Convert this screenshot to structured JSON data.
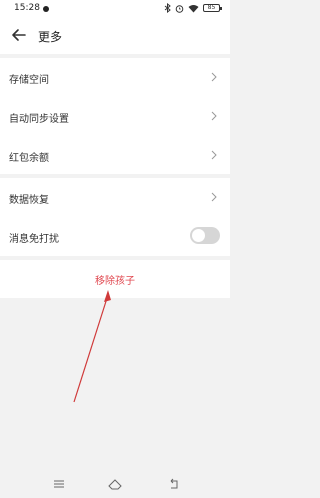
{
  "status_bar": {
    "time": "15:28",
    "battery": "85"
  },
  "header": {
    "title": "更多"
  },
  "settings_group_1": [
    {
      "label": "存储空间"
    },
    {
      "label": "自动同步设置"
    },
    {
      "label": "红包余额"
    }
  ],
  "settings_group_2": [
    {
      "label": "数据恢复"
    },
    {
      "label": "消息免打扰",
      "toggle_on": false
    }
  ],
  "remove_link": {
    "label": "移除孩子"
  },
  "colors": {
    "accent_red": "#e0474f",
    "toggle_off": "#d6d6d6",
    "background": "#f2f2f2"
  },
  "icons": [
    "bluetooth-icon",
    "alarm-icon",
    "wifi-icon",
    "battery-icon",
    "back-arrow-icon",
    "chevron-right-icon",
    "nav-menu-icon",
    "nav-home-icon",
    "nav-back-icon"
  ]
}
